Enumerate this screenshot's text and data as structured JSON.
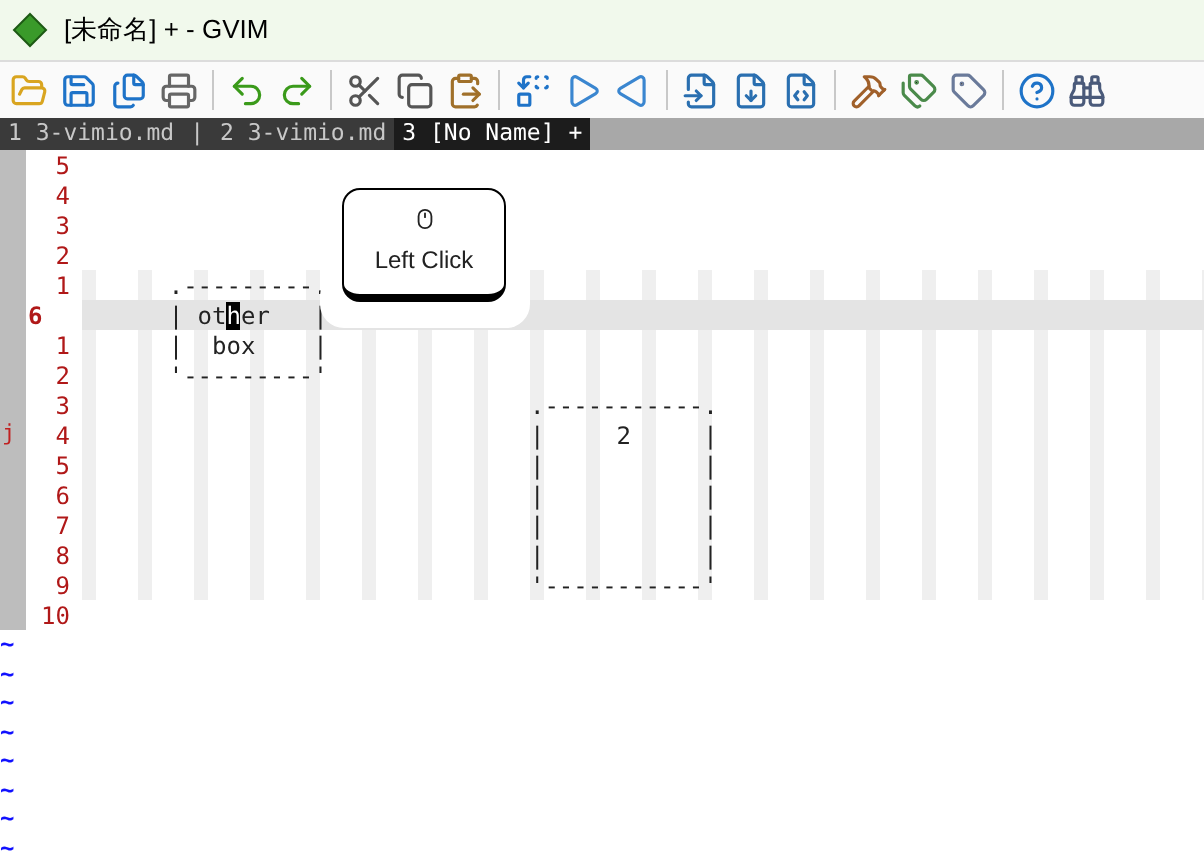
{
  "window": {
    "title": "[未命名] + - GVIM"
  },
  "tabline": {
    "tabs": [
      {
        "label": "1 3-vimio.md",
        "selected": false
      },
      {
        "label": "2 3-vimio.md",
        "selected": false
      },
      {
        "label": "3 [No Name] +",
        "selected": true
      }
    ],
    "separator": "|"
  },
  "popup": {
    "label": "Left Click"
  },
  "editor": {
    "lines": [
      {
        "number": "5",
        "current": false,
        "guides": false
      },
      {
        "number": "4",
        "current": false,
        "guides": false
      },
      {
        "number": "3",
        "current": false,
        "guides": false
      },
      {
        "number": "2",
        "current": false,
        "guides": false
      },
      {
        "number": "1",
        "text": "      .---------.",
        "current": false,
        "guides": true
      },
      {
        "number": "6",
        "text": "      | ot",
        "cursor_char": "h",
        "text_after": "er   |",
        "current": true
      },
      {
        "number": "1",
        "text": "      |  box    |",
        "current": false,
        "guides": true
      },
      {
        "number": "2",
        "text": "      '---------'",
        "current": false,
        "guides": true
      },
      {
        "number": "3",
        "text": "                               .-----------.",
        "current": false,
        "guides": true
      },
      {
        "number": "4",
        "sign": "j",
        "text": "                               |     2     |",
        "current": false,
        "guides": true
      },
      {
        "number": "5",
        "text": "                               |           |",
        "current": false,
        "guides": true
      },
      {
        "number": "6",
        "text": "                               |           |",
        "current": false,
        "guides": true
      },
      {
        "number": "7",
        "text": "                               |           |",
        "current": false,
        "guides": true
      },
      {
        "number": "8",
        "text": "                               |           |",
        "current": false,
        "guides": true
      },
      {
        "number": "9",
        "text": "                               '-----------'",
        "current": false,
        "guides": true
      },
      {
        "number": "10",
        "current": false,
        "guides": false
      }
    ],
    "filler": [
      "~",
      "~",
      "~",
      "~",
      "~",
      "~",
      "~",
      "~"
    ]
  }
}
